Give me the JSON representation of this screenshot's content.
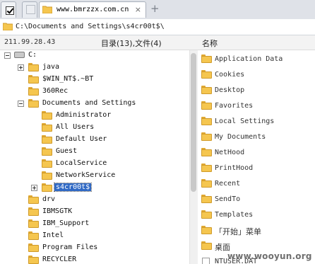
{
  "browser": {
    "active_tab_title": "www.bmrzzx.com.cn",
    "new_tab_symbol": "+"
  },
  "address": {
    "path": "C:\\Documents and Settings\\s4cr00t$\\"
  },
  "status": {
    "server_ip": "211.99.28.43",
    "counts": "目录(13),文件(4)",
    "name_header": "名称"
  },
  "tree": {
    "root": "C:",
    "items": [
      {
        "label": "java",
        "expander": "+"
      },
      {
        "label": "$WIN_NT$.~BT",
        "expander": ""
      },
      {
        "label": "360Rec",
        "expander": ""
      },
      {
        "label": "Documents and Settings",
        "expander": "-"
      },
      {
        "label": "Administrator",
        "expander": ""
      },
      {
        "label": "All Users",
        "expander": ""
      },
      {
        "label": "Default User",
        "expander": ""
      },
      {
        "label": "Guest",
        "expander": ""
      },
      {
        "label": "LocalService",
        "expander": ""
      },
      {
        "label": "NetworkService",
        "expander": ""
      },
      {
        "label": "s4cr00t$",
        "expander": "+",
        "selected": true
      },
      {
        "label": "drv",
        "expander": ""
      },
      {
        "label": "IBMSGTK",
        "expander": ""
      },
      {
        "label": "IBM_Support",
        "expander": ""
      },
      {
        "label": "Intel",
        "expander": ""
      },
      {
        "label": "Program Files",
        "expander": ""
      },
      {
        "label": "RECYCLER",
        "expander": ""
      }
    ]
  },
  "files": {
    "items": [
      {
        "label": "Application Data"
      },
      {
        "label": "Cookies"
      },
      {
        "label": "Desktop"
      },
      {
        "label": "Favorites"
      },
      {
        "label": "Local Settings"
      },
      {
        "label": "My Documents"
      },
      {
        "label": "NetHood"
      },
      {
        "label": "PrintHood"
      },
      {
        "label": "Recent"
      },
      {
        "label": "SendTo"
      },
      {
        "label": "Templates"
      },
      {
        "label": "「开始」菜单"
      },
      {
        "label": "桌面"
      },
      {
        "label": "NTUSER.DAT"
      }
    ]
  },
  "watermark": "www.wooyun.org",
  "colors": {
    "folder_fill": "#f5c64f",
    "selection": "#316ac5"
  },
  "icons": {
    "tab_icon": "folder-icon",
    "drive_icon": "hard-drive-icon",
    "check_icon": "checkbox-icon"
  }
}
